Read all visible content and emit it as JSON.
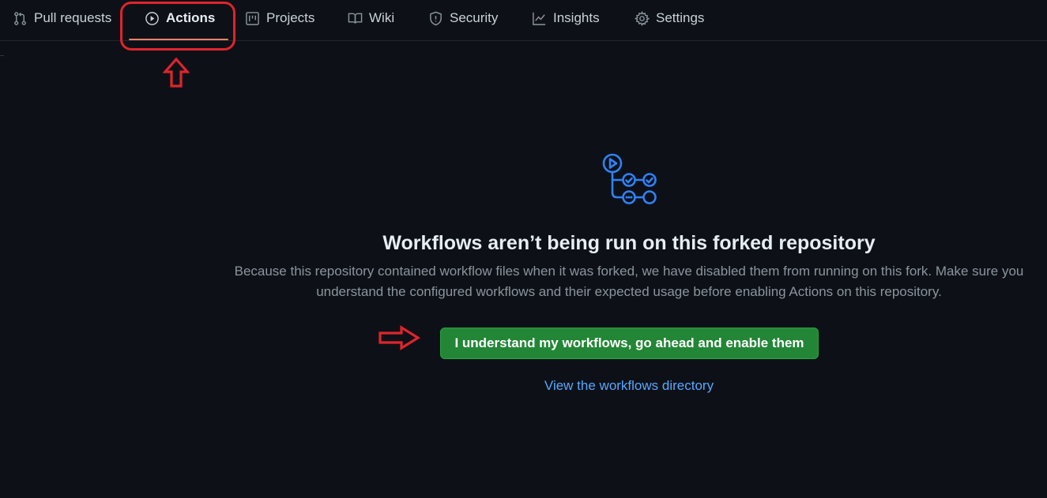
{
  "nav": {
    "tabs": [
      {
        "label": "Pull requests",
        "icon": "git-pull-request-icon"
      },
      {
        "label": "Actions",
        "icon": "play-icon",
        "active": true
      },
      {
        "label": "Projects",
        "icon": "project-icon"
      },
      {
        "label": "Wiki",
        "icon": "book-icon"
      },
      {
        "label": "Security",
        "icon": "shield-icon"
      },
      {
        "label": "Insights",
        "icon": "graph-icon"
      },
      {
        "label": "Settings",
        "icon": "gear-icon"
      }
    ]
  },
  "blankslate": {
    "icon": "workflow-icon",
    "title": "Workflows aren’t being run on this forked repository",
    "description": "Because this repository contained workflow files when it was forked, we have disabled them from running on this fork. Make sure you understand the configured workflows and their expected usage before enabling Actions on this repository.",
    "enable_button": "I understand my workflows, go ahead and enable them",
    "view_link": "View the workflows directory"
  },
  "colors": {
    "background": "#0d1117",
    "accent_underline": "#f78166",
    "button_green": "#238636",
    "link_blue": "#58a6ff",
    "icon_blue": "#2f81f7",
    "annotation_red": "#e0242c"
  }
}
